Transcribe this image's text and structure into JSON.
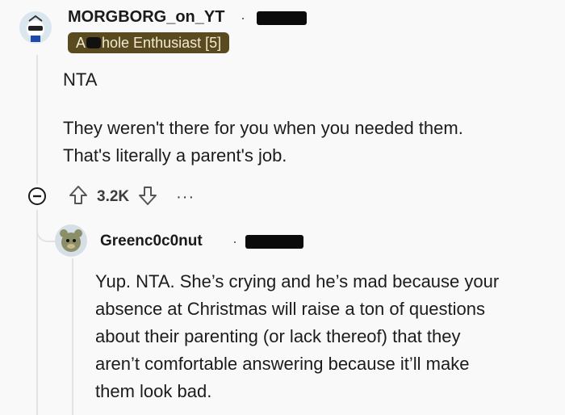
{
  "comment": {
    "username": "MORGBORG_on_YT",
    "separator": "·",
    "flair_prefix": "A",
    "flair_suffix": "hole Enthusiast [5]",
    "paragraphs": [
      "NTA",
      "They weren't there for you when you needed them.",
      "That's literally a parent's job."
    ],
    "score": "3.2K",
    "more_label": "···"
  },
  "reply": {
    "username": "Greenc0c0nut",
    "separator": "·",
    "lines": [
      "Yup. NTA. She’s crying and he’s mad because your",
      "absence at Christmas will raise a ton of questions",
      "about their parenting (or lack thereof) that they",
      "aren’t comfortable answering because it’ll make",
      "them look bad."
    ]
  },
  "colors": {
    "flair_bg": "#5a4a1f",
    "flair_text": "#f3ead2",
    "thread_line": "#e3e3e3"
  },
  "icons": [
    "collapse-icon",
    "upvote-icon",
    "downvote-icon",
    "more-options-icon"
  ]
}
